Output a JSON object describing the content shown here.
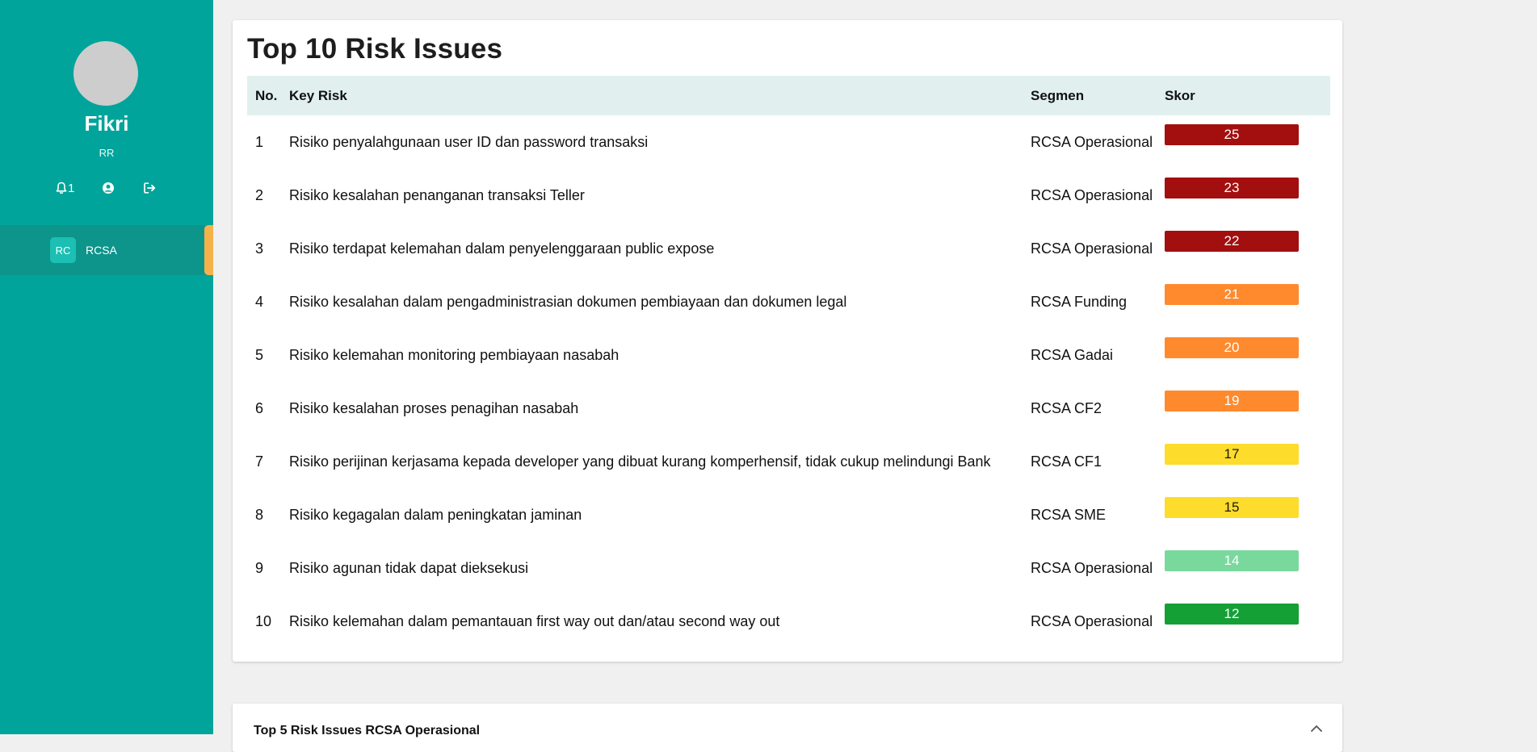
{
  "sidebar": {
    "user_name": "Fikri",
    "user_role": "RR",
    "notification_count": "1",
    "nav": [
      {
        "badge": "RC",
        "label": "RCSA"
      }
    ],
    "accent_color": "#00a49a",
    "active_indicator_color": "#f6b24a"
  },
  "main": {
    "title": "Top 10 Risk Issues",
    "table": {
      "headers": {
        "no": "No.",
        "key_risk": "Key Risk",
        "segmen": "Segmen",
        "skor": "Skor"
      },
      "rows": [
        {
          "no": "1",
          "key_risk": "Risiko penyalahgunaan user ID dan password transaksi",
          "segmen": "RCSA Operasional",
          "skor": "25",
          "color": "#a30f0f",
          "text_color": "#ffffff"
        },
        {
          "no": "2",
          "key_risk": "Risiko kesalahan penanganan transaksi Teller",
          "segmen": "RCSA Operasional",
          "skor": "23",
          "color": "#a30f0f",
          "text_color": "#ffffff"
        },
        {
          "no": "3",
          "key_risk": "Risiko terdapat kelemahan dalam penyelenggaraan public expose",
          "segmen": "RCSA Operasional",
          "skor": "22",
          "color": "#a30f0f",
          "text_color": "#ffffff"
        },
        {
          "no": "4",
          "key_risk": "Risiko kesalahan dalam pengadministrasian dokumen pembiayaan dan dokumen legal",
          "segmen": "RCSA Funding",
          "skor": "21",
          "color": "#ff8a2e",
          "text_color": "#ffffff"
        },
        {
          "no": "5",
          "key_risk": "Risiko kelemahan monitoring pembiayaan nasabah",
          "segmen": "RCSA Gadai",
          "skor": "20",
          "color": "#ff8a2e",
          "text_color": "#ffffff"
        },
        {
          "no": "6",
          "key_risk": "Risiko kesalahan proses penagihan nasabah",
          "segmen": "RCSA CF2",
          "skor": "19",
          "color": "#ff8a2e",
          "text_color": "#ffffff"
        },
        {
          "no": "7",
          "key_risk": "Risiko perijinan kerjasama kepada developer yang dibuat kurang komperhensif, tidak cukup melindungi Bank",
          "segmen": "RCSA CF1",
          "skor": "17",
          "color": "#fddc2b",
          "text_color": "#1a1a1a"
        },
        {
          "no": "8",
          "key_risk": "Risiko kegagalan dalam peningkatan jaminan",
          "segmen": "RCSA SME",
          "skor": "15",
          "color": "#fddc2b",
          "text_color": "#1a1a1a"
        },
        {
          "no": "9",
          "key_risk": "Risiko agunan tidak dapat dieksekusi",
          "segmen": "RCSA Operasional",
          "skor": "14",
          "color": "#79d99d",
          "text_color": "#ffffff"
        },
        {
          "no": "10",
          "key_risk": "Risiko kelemahan dalam pemantauan first way out dan/atau second way out",
          "segmen": "RCSA Operasional",
          "skor": "12",
          "color": "#14a035",
          "text_color": "#ffffff"
        }
      ]
    },
    "section2_title": "Top 5 Risk Issues RCSA Operasional"
  }
}
